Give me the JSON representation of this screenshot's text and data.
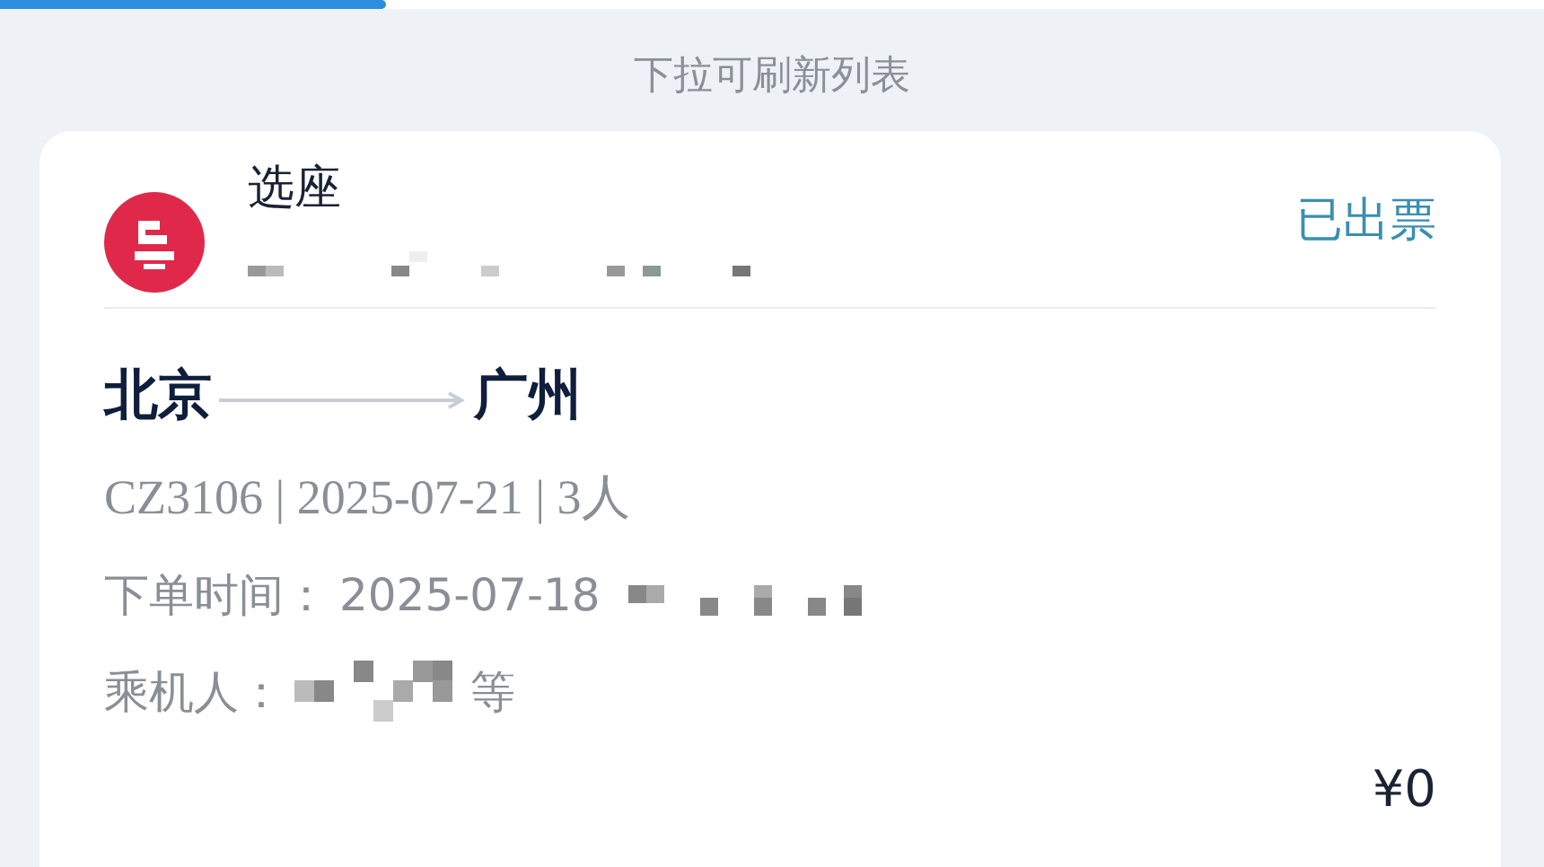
{
  "loading_bar": {
    "level": 0.25
  },
  "pull_hint": "下拉可刷新列表",
  "order": {
    "title": "选座",
    "status": "已出票",
    "from": "北京",
    "to": "广州",
    "flight_info": "CZ3106 | 2025-07-21 | 3人",
    "order_time_label": "下单时间：",
    "order_time": "2025-07-18",
    "passenger_label": "乘机人：",
    "passenger_suffix": "等",
    "price": "¥0"
  }
}
